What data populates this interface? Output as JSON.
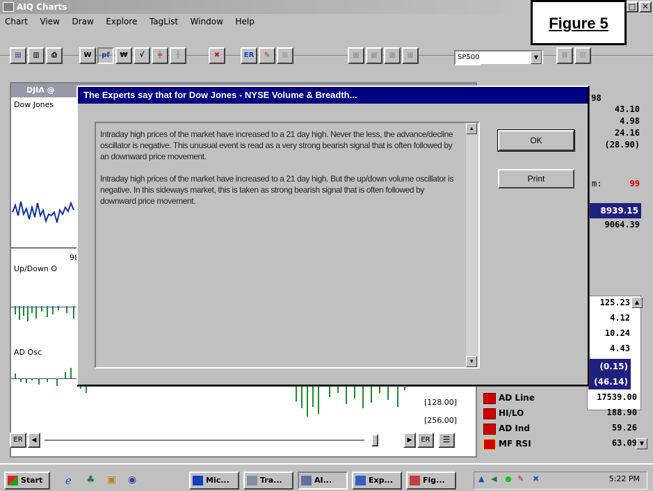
{
  "window": {
    "title": "AIQ Charts"
  },
  "figure_label": "Figure 5",
  "menu": [
    "Chart",
    "View",
    "Draw",
    "Explore",
    "TagList",
    "Window",
    "Help"
  ],
  "toolbar": {
    "symbol": "SP500"
  },
  "chart_window": {
    "title": "DJIA @",
    "labels": {
      "dow": "Dow Jones",
      "year": "98",
      "updown": "Up/Down O",
      "adosc": "AD Osc",
      "v1": "[128.00]",
      "v2": "[256.00]"
    }
  },
  "dialog": {
    "title": "The Experts say that for Dow Jones - NYSE Volume & Breadth...",
    "paragraphs": [
      "Intraday high prices of the market have increased to a 21 day high.  Never the less, the advance/decline oscillator is negative.  This unusual event is read as a very strong bearish signal that is often  followed by an downward price movement.",
      "Intraday high prices of the market have increased to a 21 day high.  But the up/down volume oscillator is negative.  In this sideways market, this is taken as strong bearish signal that is often followed by downward price movement."
    ],
    "ok_label": "OK",
    "print_label": "Print"
  },
  "right_panel": {
    "top_frag": "'98",
    "vals1": [
      "43.10",
      "4.98",
      "24.16",
      "(28.90)"
    ],
    "er_frag": "m:",
    "er_val": "99",
    "sel1": "8939.15",
    "val2": "9064.39",
    "list_vals": [
      "125.23",
      "4.12",
      "10.24",
      "4.43",
      "(0.15)",
      "(46.14)"
    ],
    "rows": [
      {
        "name": "AD Line",
        "value": "17539.00"
      },
      {
        "name": "HI/LO",
        "value": "188.90"
      },
      {
        "name": "AD Ind",
        "value": "59.26"
      },
      {
        "name": "MF RSI",
        "value": "63.09"
      }
    ]
  },
  "bottom": {
    "er_left": "ER",
    "er_right": "ER"
  },
  "taskbar": {
    "start": "Start",
    "tasks": [
      "Mic...",
      "Tra...",
      "AI...",
      "Exp...",
      "Fig..."
    ],
    "clock": "5:22 PM"
  },
  "colors": {
    "dialog_title": "#000080",
    "accent_red": "#d00000",
    "selection": "#202080"
  }
}
